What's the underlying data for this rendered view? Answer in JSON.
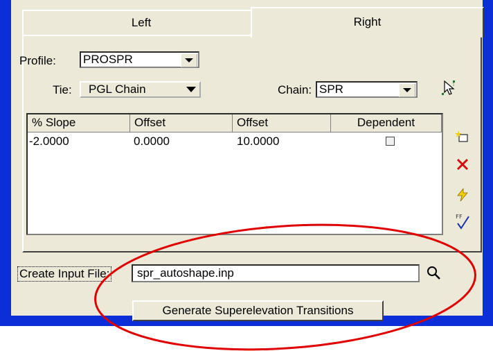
{
  "tabs": [
    {
      "label": "Left"
    },
    {
      "label": "Right"
    }
  ],
  "profile": {
    "label": "Profile:",
    "value": "PROSPR"
  },
  "tie": {
    "label": "Tie:",
    "value": "PGL Chain"
  },
  "chain": {
    "label": "Chain:",
    "value": "SPR"
  },
  "table": {
    "headers": [
      "% Slope",
      "Offset",
      "Offset",
      "Dependent"
    ],
    "rows": [
      {
        "slope": "-2.0000",
        "offset1": "0.0000",
        "offset2": "10.0000",
        "dependent": false
      }
    ]
  },
  "side_icons": [
    "add-row-icon",
    "delete-icon",
    "lightning-icon",
    "check-all-icon"
  ],
  "input_file": {
    "label": "Create Input File:",
    "value": "spr_autoshape.inp"
  },
  "generate_button": {
    "label": "Generate Superelevation Transitions"
  },
  "colors": {
    "frame": "#0a2fd8",
    "dialog": "#ece9d8",
    "annotation": "#e00000"
  }
}
